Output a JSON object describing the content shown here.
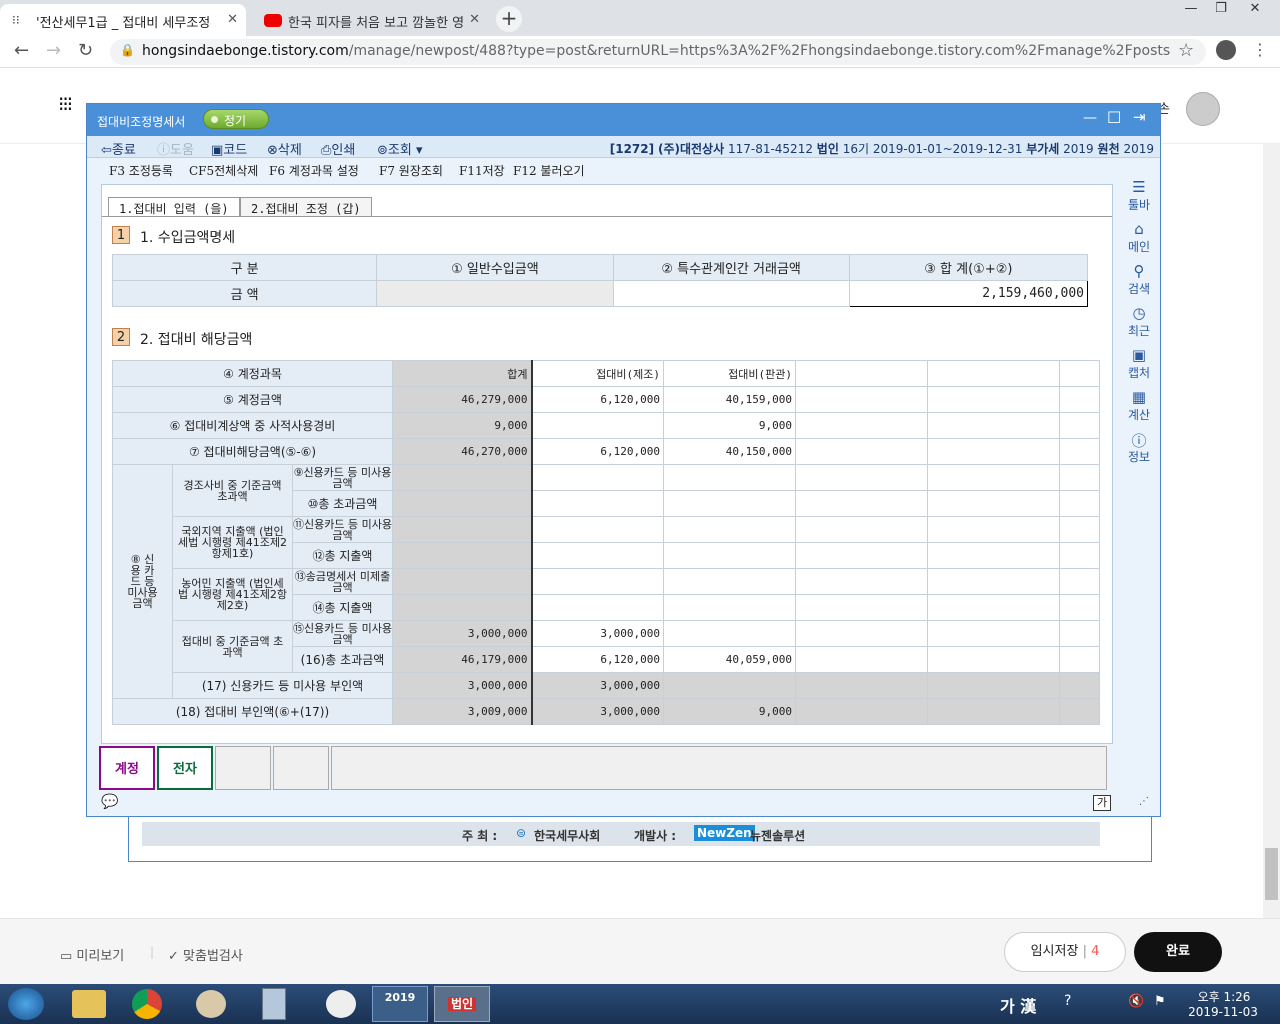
{
  "browser": {
    "tab1_title": "'전산세무1급 _ 접대비 세무조정",
    "tab2_title": "한국 피자를 처음 보고 깜놀한 영",
    "url_host": "hongsindaebonge.tistory.com",
    "url_path": "/manage/newpost/488?type=post&returnURL=https%3A%2F%2Fhongsindaebonge.tistory.com%2Fmanage%2Fposts"
  },
  "page": {
    "user_label": "손",
    "preview": "미리보기",
    "spellcheck": "맞춤법검사",
    "temp_save": "임시저장",
    "temp_count": "4",
    "done": "완료"
  },
  "app": {
    "title": "접대비조정명세서",
    "badge": "정기",
    "toolbar": {
      "close": "종료",
      "help": "도움",
      "code": "코드",
      "delete": "삭제",
      "print": "인쇄",
      "view": "조회"
    },
    "company": {
      "code": "[1272]",
      "name": "(주)대전상사",
      "bizno": "117-81-45212",
      "type": "법인",
      "period": "16기 2019-01-01~2019-12-31",
      "vat_label": "부가세",
      "vat_year": "2019",
      "source_label": "원천",
      "source_year": "2019"
    },
    "fkeys": [
      "F3 조정등록",
      "CF5전체삭제",
      "F6 계정과목 설정",
      "F7 원장조회",
      "F11저장",
      "F12 불러오기"
    ],
    "side": [
      "툴바",
      "메인",
      "검색",
      "최근",
      "캡처",
      "계산",
      "정보"
    ],
    "tabs": [
      "1.접대비 입력 (을)",
      "2.접대비 조정 (갑)"
    ],
    "sec1": {
      "num": "1",
      "title": "1. 수입금액명세",
      "headers": [
        "구      분",
        "① 일반수입금액",
        "② 특수관계인간 거래금액",
        "③ 합      계(①+②)"
      ],
      "row_label": "금      액",
      "total": "2,159,460,000"
    },
    "sec2": {
      "num": "2",
      "title": "2. 접대비 해당금액",
      "col_label": "④ 계정과목",
      "cols": [
        "합계",
        "접대비(제조)",
        "접대비(판관)"
      ],
      "r5": {
        "label": "⑤ 계정금액",
        "v": [
          "46,279,000",
          "6,120,000",
          "40,159,000"
        ]
      },
      "r6": {
        "label": "⑥ 접대비계상액 중 사적사용경비",
        "v": [
          "9,000",
          "",
          "9,000"
        ]
      },
      "r7": {
        "label": "⑦ 접대비해당금액(⑤-⑥)",
        "v": [
          "46,270,000",
          "6,120,000",
          "40,150,000"
        ]
      },
      "g8": "⑧ 신용 카드 등 미사용 금액",
      "g_a": "경조사비 중 기준금액 초과액",
      "r9": "⑨신용카드 등 미사용금액",
      "r10": "⑩총 초과금액",
      "g_b": "국외지역 지출액 (법인세법 시행령 제41조제2항제1호)",
      "r11": "⑪신용카드 등 미사용금액",
      "r12": "⑫총 지출액",
      "g_c": "농어민 지출액 (법인세법 시행령 제41조제2항제2호)",
      "r13": "⑬송금명세서 미제출금액",
      "r14": "⑭총 지출액",
      "g_d": "접대비 중 기준금액 초과액",
      "r15": {
        "label": "⑮신용카드 등 미사용금액",
        "v": [
          "3,000,000",
          "3,000,000",
          ""
        ]
      },
      "r16": {
        "label": "(16)총 초과금액",
        "v": [
          "46,179,000",
          "6,120,000",
          "40,059,000"
        ]
      },
      "r17": {
        "label": "(17) 신용카드 등 미사용 부인액",
        "v": [
          "3,000,000",
          "3,000,000",
          ""
        ]
      },
      "r18": {
        "label": "(18) 접대비 부인액(⑥+(17))",
        "v": [
          "3,009,000",
          "3,000,000",
          "9,000"
        ]
      }
    },
    "bottom_tabs": [
      "계정",
      "전자"
    ],
    "lang_btn": "가",
    "footer": {
      "host_label": "주 최 :",
      "host": "한국세무사회",
      "dev_label": "개발사 :",
      "dev_brand": "NewZen",
      "dev_name": "뉴젠솔루션"
    }
  },
  "taskbar": {
    "ime": "가 漢",
    "time": "오후 1:26",
    "date": "2019-11-03",
    "badge2019": "2019",
    "app_label": "법인"
  }
}
